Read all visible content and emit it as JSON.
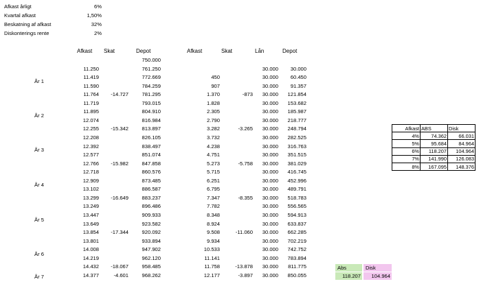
{
  "params": [
    {
      "label": "Afkast årligt",
      "value": "6%"
    },
    {
      "label": "Kvartal afkast",
      "value": "1,50%"
    },
    {
      "label": "Beskatning af afkast",
      "value": "32%"
    },
    {
      "label": "Diskonterings rente",
      "value": "2%"
    }
  ],
  "headers": {
    "afkast1": "Afkast",
    "skat1": "Skat",
    "depot1": "Depot",
    "afkast2": "Afkast",
    "skat2": "Skat",
    "laan": "Lån",
    "depot2": "Depot"
  },
  "years": [
    "År 1",
    "År 2",
    "År 3",
    "År 4",
    "År 5",
    "År 6",
    "År 7"
  ],
  "rows": [
    {
      "a1": "",
      "s1": "",
      "d1": "750.000",
      "a2": "",
      "s2": "",
      "l": "",
      "d2": ""
    },
    {
      "a1": "11.250",
      "s1": "",
      "d1": "761.250",
      "a2": "",
      "s2": "",
      "l": "30.000",
      "d2": "30.000"
    },
    {
      "a1": "11.419",
      "s1": "",
      "d1": "772.669",
      "a2": "450",
      "s2": "",
      "l": "30.000",
      "d2": "60.450"
    },
    {
      "a1": "11.590",
      "s1": "",
      "d1": "784.259",
      "a2": "907",
      "s2": "",
      "l": "30.000",
      "d2": "91.357"
    },
    {
      "a1": "11.764",
      "s1": "-14.727",
      "d1": "781.295",
      "a2": "1.370",
      "s2": "-873",
      "l": "30.000",
      "d2": "121.854"
    },
    {
      "a1": "11.719",
      "s1": "",
      "d1": "793.015",
      "a2": "1.828",
      "s2": "",
      "l": "30.000",
      "d2": "153.682"
    },
    {
      "a1": "11.895",
      "s1": "",
      "d1": "804.910",
      "a2": "2.305",
      "s2": "",
      "l": "30.000",
      "d2": "185.987"
    },
    {
      "a1": "12.074",
      "s1": "",
      "d1": "816.984",
      "a2": "2.790",
      "s2": "",
      "l": "30.000",
      "d2": "218.777"
    },
    {
      "a1": "12.255",
      "s1": "-15.342",
      "d1": "813.897",
      "a2": "3.282",
      "s2": "-3.265",
      "l": "30.000",
      "d2": "248.794"
    },
    {
      "a1": "12.208",
      "s1": "",
      "d1": "826.105",
      "a2": "3.732",
      "s2": "",
      "l": "30.000",
      "d2": "282.525"
    },
    {
      "a1": "12.392",
      "s1": "",
      "d1": "838.497",
      "a2": "4.238",
      "s2": "",
      "l": "30.000",
      "d2": "316.763"
    },
    {
      "a1": "12.577",
      "s1": "",
      "d1": "851.074",
      "a2": "4.751",
      "s2": "",
      "l": "30.000",
      "d2": "351.515"
    },
    {
      "a1": "12.766",
      "s1": "-15.982",
      "d1": "847.858",
      "a2": "5.273",
      "s2": "-5.758",
      "l": "30.000",
      "d2": "381.029"
    },
    {
      "a1": "12.718",
      "s1": "",
      "d1": "860.576",
      "a2": "5.715",
      "s2": "",
      "l": "30.000",
      "d2": "416.745"
    },
    {
      "a1": "12.909",
      "s1": "",
      "d1": "873.485",
      "a2": "6.251",
      "s2": "",
      "l": "30.000",
      "d2": "452.996"
    },
    {
      "a1": "13.102",
      "s1": "",
      "d1": "886.587",
      "a2": "6.795",
      "s2": "",
      "l": "30.000",
      "d2": "489.791"
    },
    {
      "a1": "13.299",
      "s1": "-16.649",
      "d1": "883.237",
      "a2": "7.347",
      "s2": "-8.355",
      "l": "30.000",
      "d2": "518.783"
    },
    {
      "a1": "13.249",
      "s1": "",
      "d1": "896.486",
      "a2": "7.782",
      "s2": "",
      "l": "30.000",
      "d2": "556.565"
    },
    {
      "a1": "13.447",
      "s1": "",
      "d1": "909.933",
      "a2": "8.348",
      "s2": "",
      "l": "30.000",
      "d2": "594.913"
    },
    {
      "a1": "13.649",
      "s1": "",
      "d1": "923.582",
      "a2": "8.924",
      "s2": "",
      "l": "30.000",
      "d2": "633.837"
    },
    {
      "a1": "13.854",
      "s1": "-17.344",
      "d1": "920.092",
      "a2": "9.508",
      "s2": "-11.060",
      "l": "30.000",
      "d2": "662.285"
    },
    {
      "a1": "13.801",
      "s1": "",
      "d1": "933.894",
      "a2": "9.934",
      "s2": "",
      "l": "30.000",
      "d2": "702.219"
    },
    {
      "a1": "14.008",
      "s1": "",
      "d1": "947.902",
      "a2": "10.533",
      "s2": "",
      "l": "30.000",
      "d2": "742.752"
    },
    {
      "a1": "14.219",
      "s1": "",
      "d1": "962.120",
      "a2": "11.141",
      "s2": "",
      "l": "30.000",
      "d2": "783.894"
    },
    {
      "a1": "14.432",
      "s1": "-18.067",
      "d1": "958.485",
      "a2": "11.758",
      "s2": "-13.878",
      "l": "30.000",
      "d2": "811.775"
    },
    {
      "a1": "14.377",
      "s1": "-4.601",
      "d1": "968.262",
      "a2": "12.177",
      "s2": "-3.897",
      "l": "30.000",
      "d2": "850.055"
    }
  ],
  "side_table": {
    "headers": [
      "Afkast",
      "ABS",
      "Disk"
    ],
    "rows": [
      [
        "4%",
        "74.362",
        "66.031"
      ],
      [
        "5%",
        "95.684",
        "84.964"
      ],
      [
        "6%",
        "118.207",
        "104.964"
      ],
      [
        "7%",
        "141.990",
        "126.083"
      ],
      [
        "8%",
        "167.095",
        "148.376"
      ]
    ]
  },
  "summary": {
    "abs_label": "Abs",
    "disk_label": "Disk",
    "abs_value": "118.207",
    "disk_value": "104.964"
  },
  "colors": {
    "abs_fill": "#c9e9b8",
    "disk_fill": "#f2c6ee"
  }
}
